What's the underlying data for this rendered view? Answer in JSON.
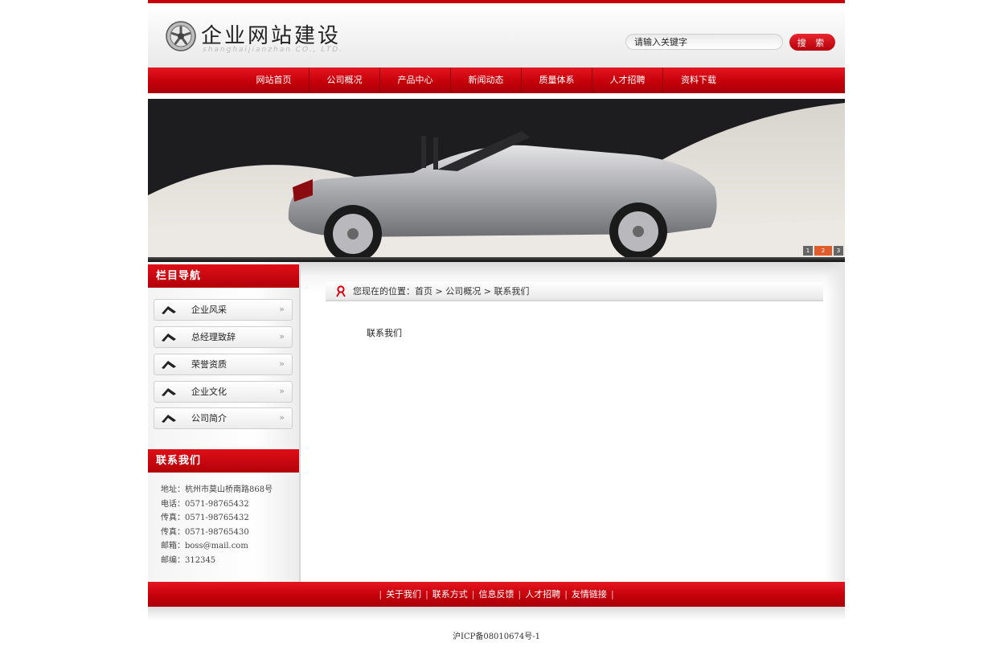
{
  "brand": {
    "name": "企业网站建设",
    "subtitle": "shanghaijianzhan CO., LTD."
  },
  "search": {
    "placeholder": "请输入关键字",
    "button_label": "搜 索"
  },
  "main_nav": {
    "items": [
      "网站首页",
      "公司概况",
      "产品中心",
      "新闻动态",
      "质量体系",
      "人才招聘",
      "资料下载"
    ]
  },
  "banner": {
    "slides": [
      "1",
      "2",
      "3"
    ],
    "active_slide": 2
  },
  "sidebar": {
    "nav_heading": "栏目导航",
    "nav_items": [
      {
        "label": "企业风采"
      },
      {
        "label": "总经理致辞"
      },
      {
        "label": "荣誉资质"
      },
      {
        "label": "企业文化"
      },
      {
        "label": "公司简介"
      }
    ],
    "contact_heading": "联系我们",
    "contact": [
      "地址：杭州市莫山桥南路868号",
      "电话：0571-98765432",
      "传真：0571-98765432",
      "传真：0571-98765430",
      "邮箱：boss@mail.com",
      "邮编：312345"
    ]
  },
  "breadcrumb": {
    "prefix": "您现在的位置：",
    "items": [
      "首页",
      "公司概况",
      "联系我们"
    ],
    "separator": " > "
  },
  "content": {
    "title": "联系我们"
  },
  "footer": {
    "links": [
      "关于我们",
      "联系方式",
      "信息反馈",
      "人才招聘",
      "友情链接"
    ],
    "icp": "沪ICP备08010674号-1"
  },
  "colors": {
    "accent": "#c8000a",
    "accent_light": "#e5161f"
  }
}
